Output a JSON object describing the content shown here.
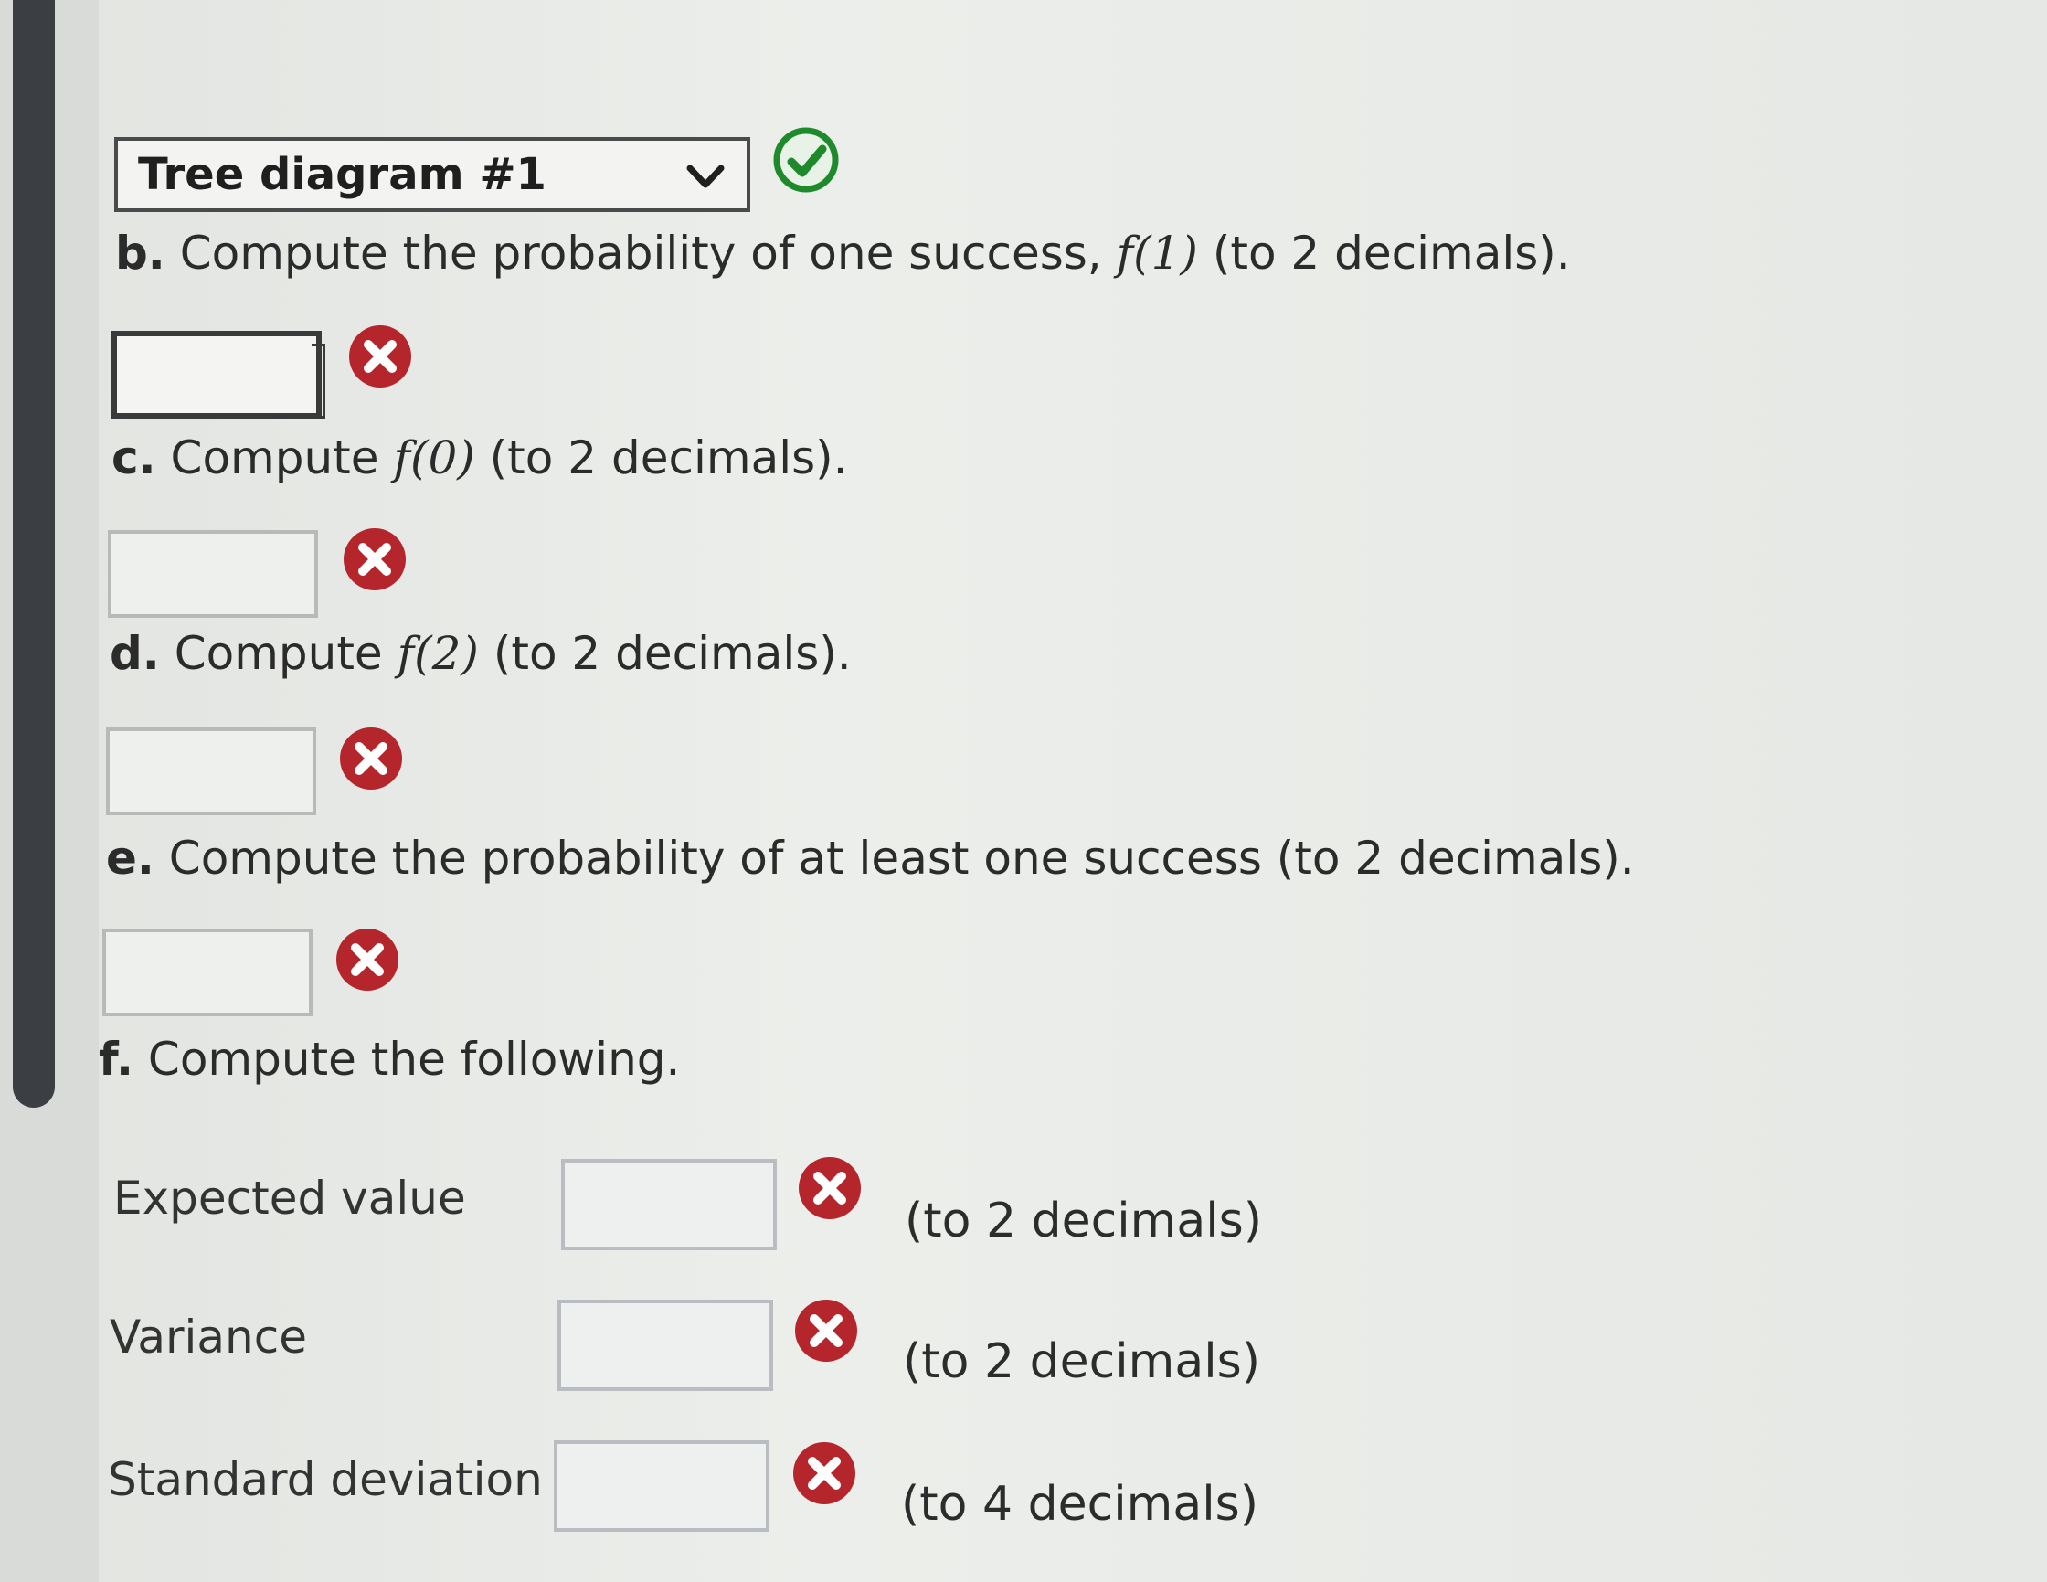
{
  "dropdown": {
    "selected": "Tree diagram #1",
    "status": "correct"
  },
  "questions": {
    "b": {
      "part": "b.",
      "text_before": " Compute the probability of one success, ",
      "func": "f(1)",
      "text_after": " (to 2 decimals).",
      "value": "",
      "status": "incorrect"
    },
    "c": {
      "part": "c.",
      "text_before": " Compute ",
      "func": "f(0)",
      "text_after": " (to 2 decimals).",
      "value": "",
      "status": "incorrect"
    },
    "d": {
      "part": "d.",
      "text_before": " Compute ",
      "func": "f(2)",
      "text_after": " (to 2 decimals).",
      "value": "",
      "status": "incorrect"
    },
    "e": {
      "part": "e.",
      "text": " Compute the probability of at least one success (to 2 decimals).",
      "value": "",
      "status": "incorrect"
    },
    "f": {
      "part": "f.",
      "text": " Compute the following."
    }
  },
  "rows": [
    {
      "label": "Expected value",
      "hint": "(to 2 decimals)",
      "value": "",
      "status": "incorrect"
    },
    {
      "label": "Variance",
      "hint": "(to 2 decimals)",
      "value": "",
      "status": "incorrect"
    },
    {
      "label": "Standard deviation",
      "hint": "(to 4 decimals)",
      "value": "",
      "status": "incorrect"
    }
  ],
  "colors": {
    "correct_green": "#1e8a2c",
    "incorrect_red": "#b5262c",
    "scrollbar": "#3b3f44"
  },
  "icons": {
    "correct": "check-circle-icon",
    "incorrect": "x-circle-icon",
    "dropdown": "chevron-down-icon"
  }
}
